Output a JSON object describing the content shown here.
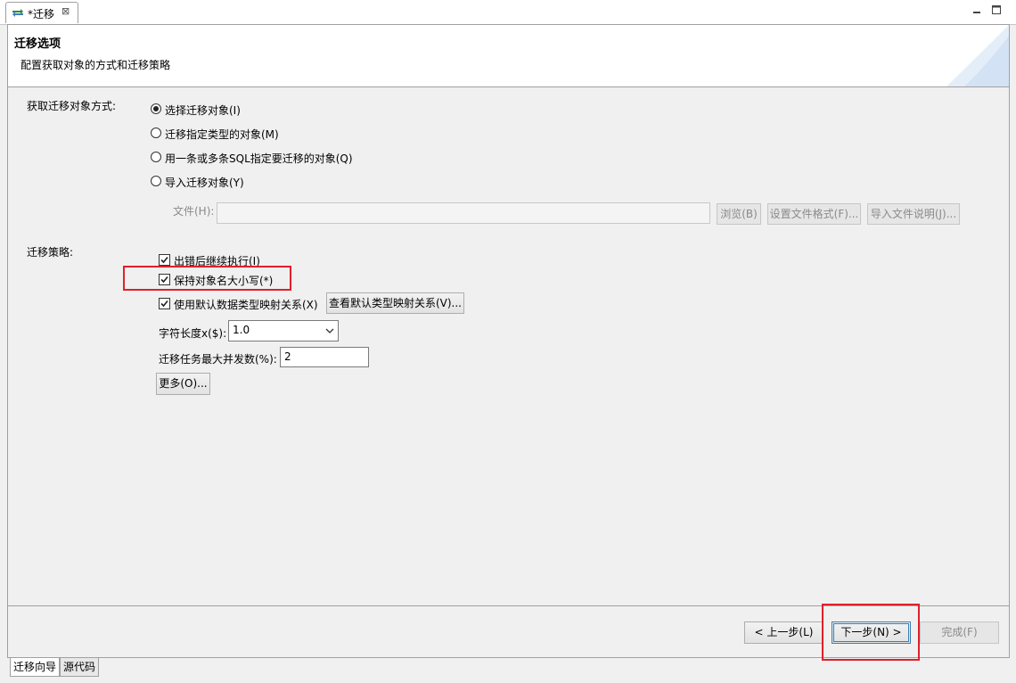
{
  "editor": {
    "tab_title": "*迁移",
    "close_glyph": "⊠"
  },
  "header": {
    "title": "迁移选项",
    "description": "配置获取对象的方式和迁移策略"
  },
  "acquire": {
    "label": "获取迁移对象方式:",
    "options": [
      {
        "label": "选择迁移对象(I)",
        "checked": true
      },
      {
        "label": "迁移指定类型的对象(M)",
        "checked": false
      },
      {
        "label": "用一条或多条SQL指定要迁移的对象(Q)",
        "checked": false
      },
      {
        "label": "导入迁移对象(Y)",
        "checked": false
      }
    ],
    "file_label": "文件(H):",
    "file_value": "",
    "browse_button": "浏览(B)",
    "format_button": "设置文件格式(F)...",
    "help_button": "导入文件说明(J)..."
  },
  "strategy": {
    "label": "迁移策略:",
    "continue_on_error": {
      "label": "出错后继续执行(I)",
      "checked": true
    },
    "keep_case": {
      "label": "保持对象名大小写(*)",
      "checked": true
    },
    "default_mapping": {
      "label": "使用默认数据类型映射关系(X)",
      "checked": true
    },
    "view_mapping_button": "查看默认类型映射关系(V)...",
    "char_length_label": "字符长度x($):",
    "char_length_value": "1.0",
    "max_concurrency_label": "迁移任务最大并发数(%):",
    "max_concurrency_value": "2",
    "more_button": "更多(O)..."
  },
  "footer": {
    "back_button": "< 上一步(L)",
    "next_button": "下一步(N) >",
    "finish_button": "完成(F)"
  },
  "bottom_tabs": [
    "迁移向导",
    "源代码"
  ],
  "colors": {
    "highlight": "#e0202a",
    "focus": "#3c7fb1"
  }
}
